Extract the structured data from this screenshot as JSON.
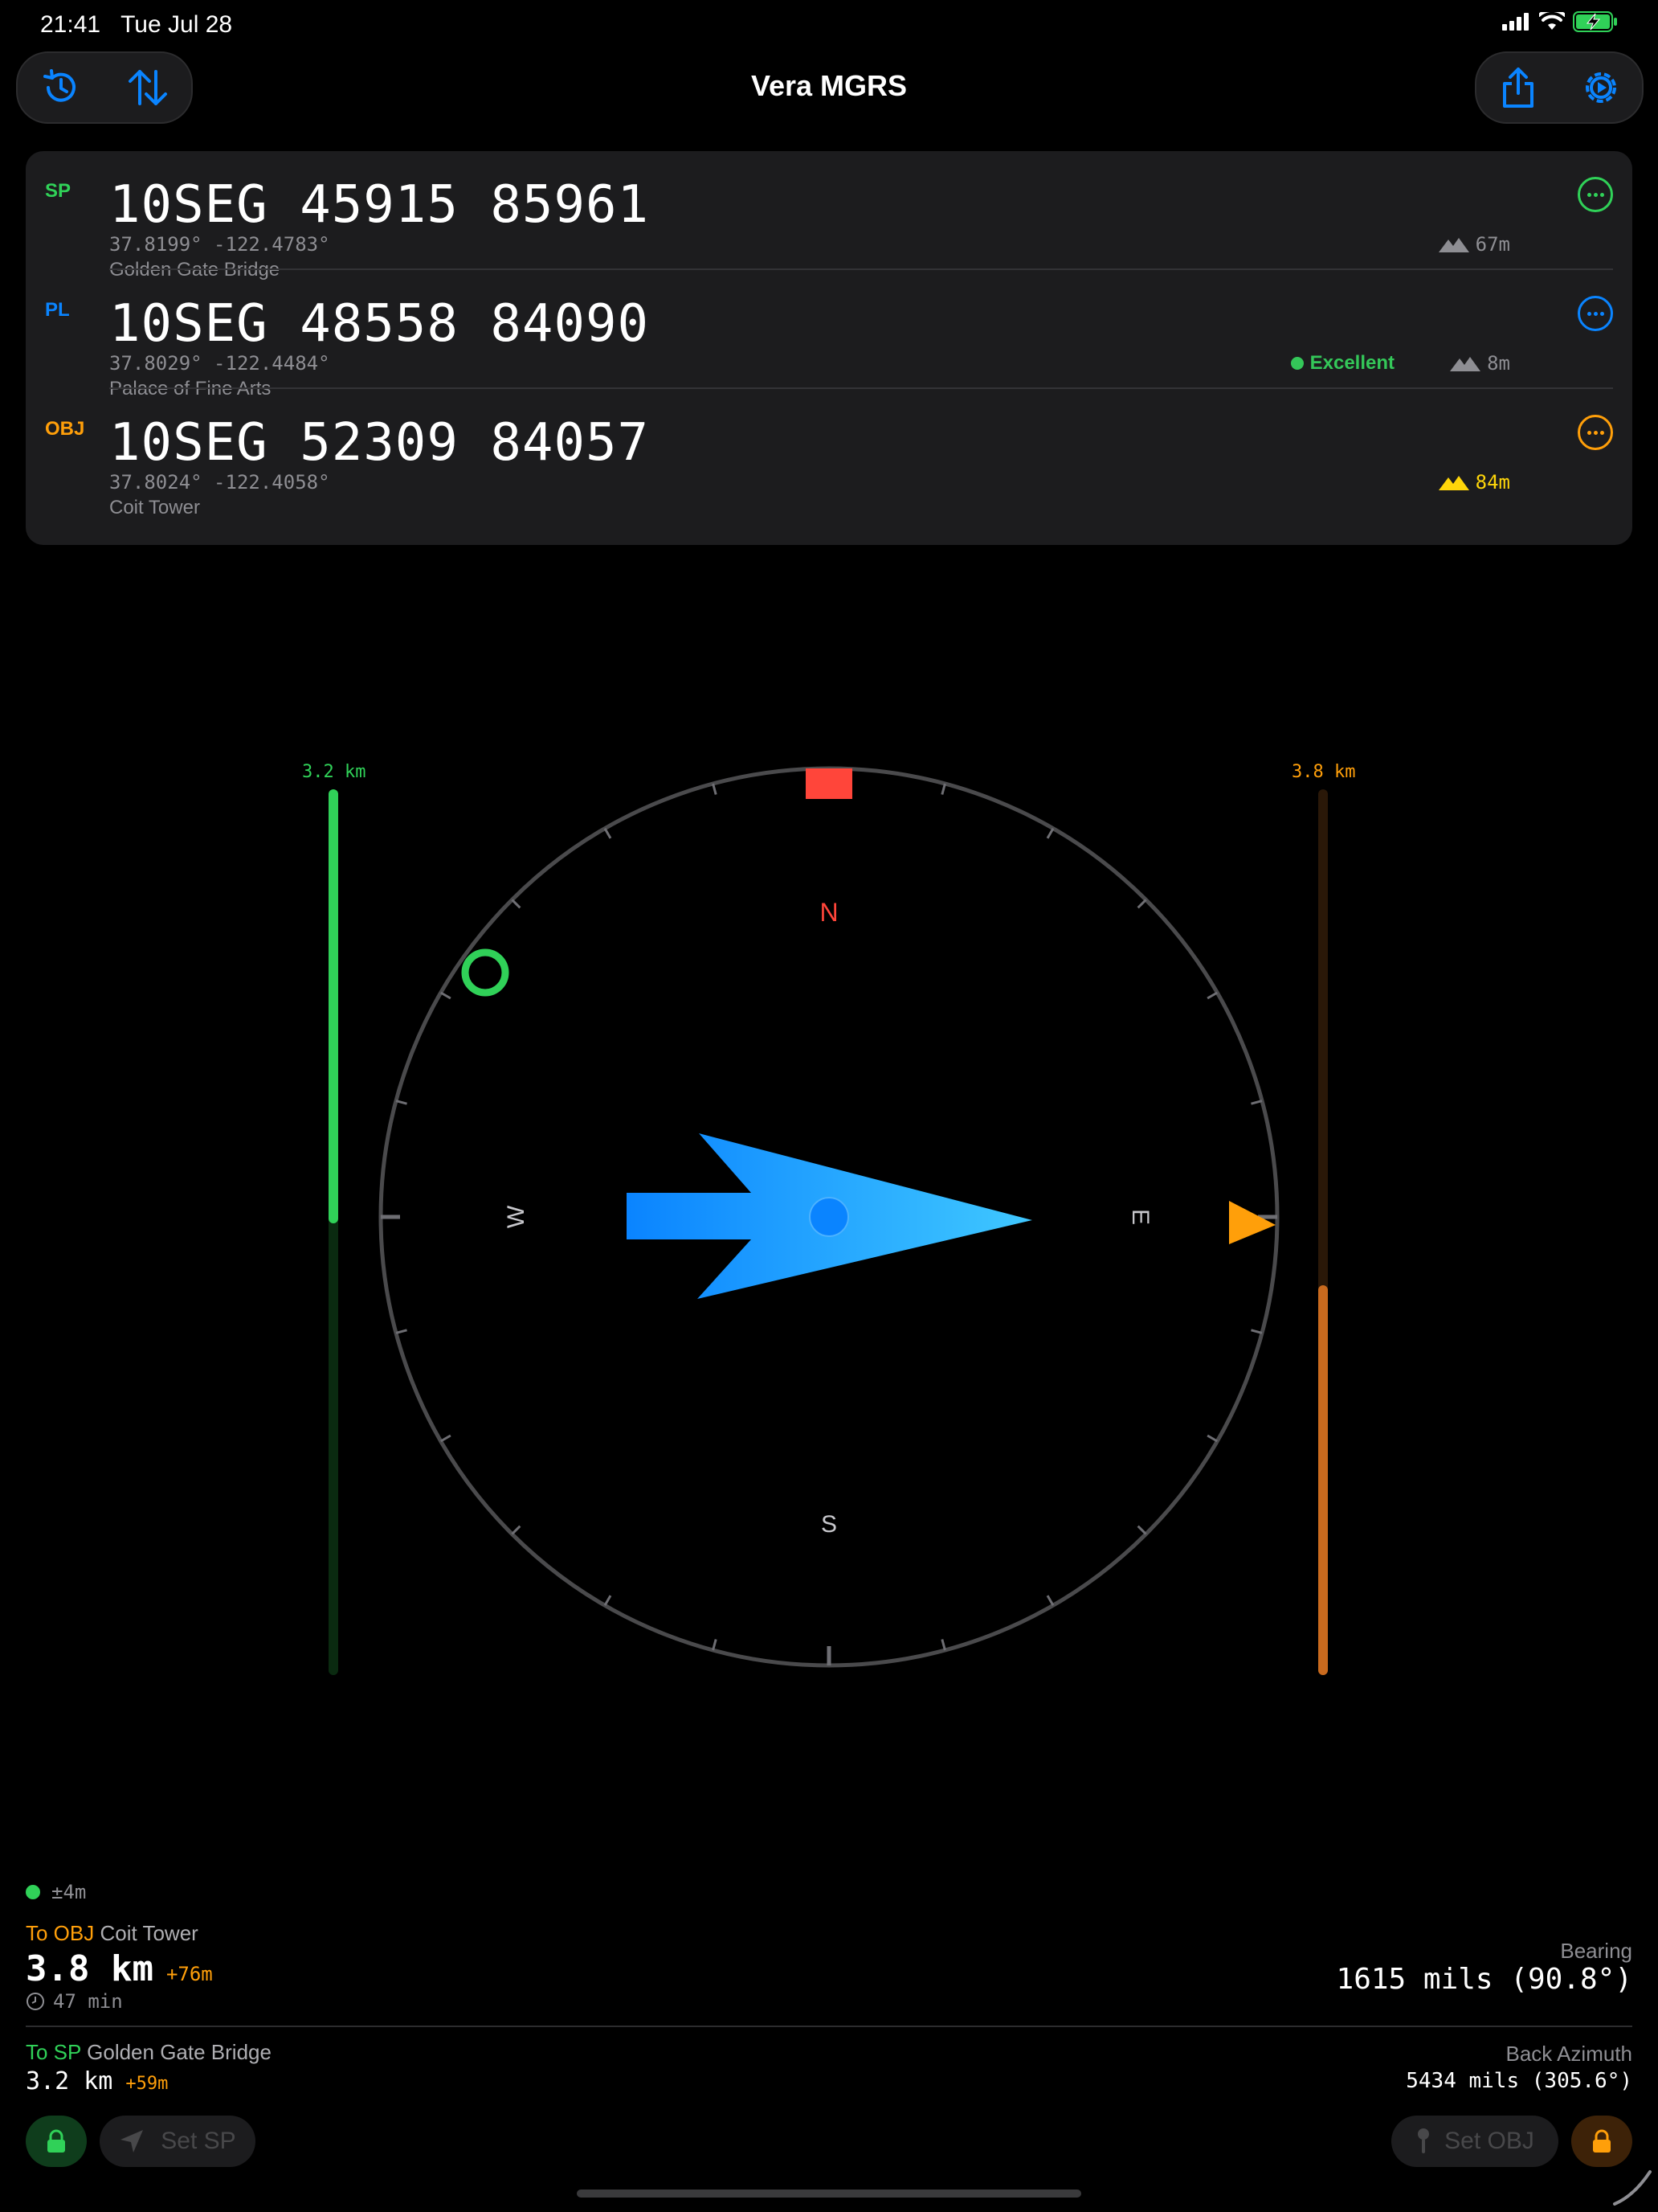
{
  "status": {
    "time": "21:41",
    "date": "Tue Jul 28"
  },
  "header": {
    "title": "Vera MGRS"
  },
  "icons": {
    "history": "history-icon",
    "swap": "swap-arrows-icon",
    "share": "share-icon",
    "settings": "settings-gear-icon"
  },
  "points": [
    {
      "tag": "SP",
      "color": "#30d158",
      "mgrs": "10SEG 45915 85961",
      "coords": "37.8199° -122.4783°",
      "place": "Golden Gate Bridge",
      "elevation": "67m",
      "quality": ""
    },
    {
      "tag": "PL",
      "color": "#0a84ff",
      "mgrs": "10SEG 48558 84090",
      "coords": "37.8029° -122.4484°",
      "place": "Palace of Fine Arts",
      "elevation": "8m",
      "quality": "Excellent"
    },
    {
      "tag": "OBJ",
      "color": "#ff9f0a",
      "mgrs": "10SEG 52309 84057",
      "coords": "37.8024° -122.4058°",
      "place": "Coit Tower",
      "elevation": "84m",
      "quality": ""
    }
  ],
  "compass": {
    "north": "N",
    "south": "S",
    "east": "E",
    "west": "W",
    "heading_deg": 90.8,
    "sp_bearing_deg": -54
  },
  "distance_bars": {
    "sp_label": "3.2 km",
    "sp_fill_fraction": 0.49,
    "sp_color": "#30d158",
    "obj_label": "3.8 km",
    "obj_fill_fraction": 0.44,
    "obj_color": "#ff9f0a"
  },
  "gps": {
    "accuracy": "±4m",
    "color": "#30d158"
  },
  "to_obj": {
    "label": "To OBJ",
    "name": "Coit Tower",
    "distance": "3.8 km",
    "elev_delta": "+76m",
    "eta": "47 min"
  },
  "bearing": {
    "label": "Bearing",
    "value": "1615 mils (90.8°)"
  },
  "to_sp": {
    "label": "To SP",
    "name": "Golden Gate Bridge",
    "distance": "3.2 km",
    "elev_delta": "+59m"
  },
  "back_azimuth": {
    "label": "Back Azimuth",
    "value": "5434 mils (305.6°)"
  },
  "buttons": {
    "set_sp": "Set SP",
    "set_obj": "Set OBJ"
  }
}
